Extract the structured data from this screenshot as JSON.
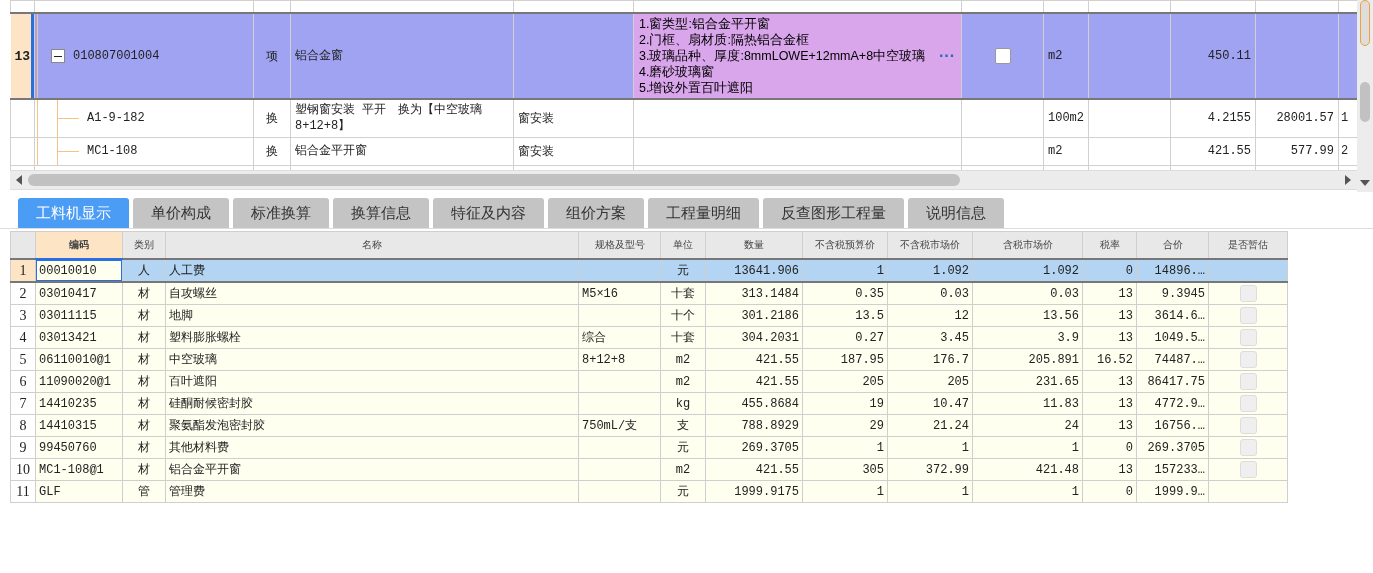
{
  "top_grid": {
    "rows": [
      {
        "number": "13",
        "code": "010807001004",
        "type": "项",
        "name": "铝合金窗",
        "features": [
          "1.窗类型:铝合金平开窗",
          "2.门框、扇材质:隔热铝合金框",
          "3.玻璃品种、厚度:8mmLOWE+12mmA+8中空玻璃",
          "4.磨砂玻璃窗",
          "5.增设外置百叶遮阳"
        ],
        "features_button": "···",
        "checked": false,
        "unit": "m2",
        "quantity": "450.11",
        "selected": true,
        "expanded": true,
        "children": [
          {
            "code": "A1-9-182",
            "type": "换",
            "name": "塑钢窗安装 平开　换为【中空玻璃8+12+8】",
            "column_4": "窗安装",
            "unit": "100m2",
            "quantity": "4.2155",
            "price": "28001.57",
            "column_12": "1",
            "selected": false
          },
          {
            "code": "MC1-108",
            "type": "换",
            "name": "铝合金平开窗",
            "column_4": "窗安装",
            "unit": "m2",
            "quantity": "421.55",
            "price": "577.99",
            "column_12": "2",
            "selected": false
          }
        ]
      }
    ]
  },
  "tabs": [
    {
      "label": "工料机显示",
      "selected": true
    },
    {
      "label": "单价构成",
      "selected": false
    },
    {
      "label": "标准换算",
      "selected": false
    },
    {
      "label": "换算信息",
      "selected": false
    },
    {
      "label": "特征及内容",
      "selected": false
    },
    {
      "label": "组价方案",
      "selected": false
    },
    {
      "label": "工程量明细",
      "selected": false
    },
    {
      "label": "反查图形工程量",
      "selected": false
    },
    {
      "label": "说明信息",
      "selected": false
    }
  ],
  "detail_grid": {
    "columns": [
      "编码",
      "类别",
      "名称",
      "规格及型号",
      "单位",
      "数量",
      "不含税预算价",
      "不含税市场价",
      "含税市场价",
      "税率",
      "合价",
      "是否暂估"
    ],
    "rows": [
      {
        "number": "1",
        "cells": [
          "00010010",
          "人",
          "人工费",
          "",
          "元",
          "13641.906",
          "1",
          "1.092",
          "1.092",
          "0",
          "14896.…"
        ],
        "selected": true
      },
      {
        "number": "2",
        "cells": [
          "03010417",
          "材",
          "自攻螺丝",
          "M5×16",
          "十套",
          "313.1484",
          "0.35",
          "0.03",
          "0.03",
          "13",
          "9.3945"
        ],
        "selected": false,
        "provisional": false
      },
      {
        "number": "3",
        "cells": [
          "03011115",
          "材",
          "地脚",
          "",
          "十个",
          "301.2186",
          "13.5",
          "12",
          "13.56",
          "13",
          "3614.6…"
        ],
        "selected": false,
        "provisional": false
      },
      {
        "number": "4",
        "cells": [
          "03013421",
          "材",
          "塑料膨胀螺栓",
          "综合",
          "十套",
          "304.2031",
          "0.27",
          "3.45",
          "3.9",
          "13",
          "1049.5…"
        ],
        "selected": false,
        "provisional": false
      },
      {
        "number": "5",
        "cells": [
          "06110010@1",
          "材",
          "中空玻璃",
          "8+12+8",
          "m2",
          "421.55",
          "187.95",
          "176.7",
          "205.891",
          "16.52",
          "74487.…"
        ],
        "selected": false,
        "provisional": false
      },
      {
        "number": "6",
        "cells": [
          "11090020@1",
          "材",
          "百叶遮阳",
          "",
          "m2",
          "421.55",
          "205",
          "205",
          "231.65",
          "13",
          "86417.75"
        ],
        "selected": false,
        "provisional": false
      },
      {
        "number": "7",
        "cells": [
          "14410235",
          "材",
          "硅酮耐候密封胶",
          "",
          "kg",
          "455.8684",
          "19",
          "10.47",
          "11.83",
          "13",
          "4772.9…"
        ],
        "selected": false,
        "provisional": false
      },
      {
        "number": "8",
        "cells": [
          "14410315",
          "材",
          "聚氨酯发泡密封胶",
          "750mL/支",
          "支",
          "788.8929",
          "29",
          "21.24",
          "24",
          "13",
          "16756.…"
        ],
        "selected": false,
        "provisional": false
      },
      {
        "number": "9",
        "cells": [
          "99450760",
          "材",
          "其他材料费",
          "",
          "元",
          "269.3705",
          "1",
          "1",
          "1",
          "0",
          "269.3705"
        ],
        "selected": false,
        "provisional": false
      },
      {
        "number": "10",
        "cells": [
          "MC1-108@1",
          "材",
          "铝合金平开窗",
          "",
          "m2",
          "421.55",
          "305",
          "372.99",
          "421.48",
          "13",
          "157233…"
        ],
        "selected": false,
        "provisional": false
      },
      {
        "number": "11",
        "cells": [
          "GLF",
          "管",
          "管理费",
          "",
          "元",
          "1999.9175",
          "1",
          "1",
          "1",
          "0",
          "1999.9…"
        ],
        "selected": false
      }
    ]
  }
}
